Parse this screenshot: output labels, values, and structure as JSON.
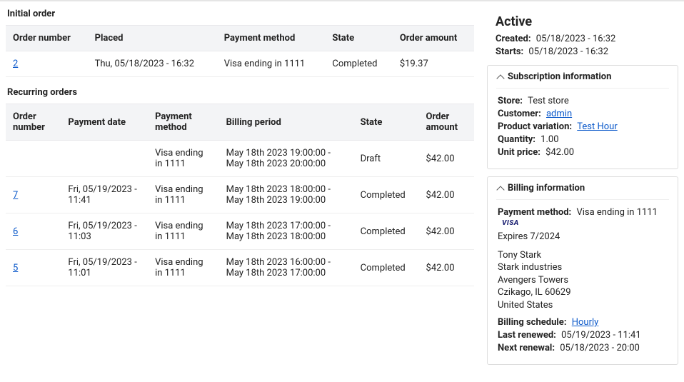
{
  "initialOrder": {
    "title": "Initial order",
    "headers": {
      "orderNumber": "Order number",
      "placed": "Placed",
      "paymentMethod": "Payment method",
      "state": "State",
      "orderAmount": "Order amount"
    },
    "rows": [
      {
        "orderNumber": "2",
        "placed": "Thu, 05/18/2023 - 16:32",
        "paymentMethod": "Visa ending in 1111",
        "state": "Completed",
        "orderAmount": "$19.37"
      }
    ]
  },
  "recurringOrders": {
    "title": "Recurring orders",
    "headers": {
      "orderNumber": "Order number",
      "paymentDate": "Payment date",
      "paymentMethod": "Payment method",
      "billingPeriod": "Billing period",
      "state": "State",
      "orderAmount": "Order amount"
    },
    "rows": [
      {
        "orderNumber": "",
        "paymentDate": "",
        "paymentMethod": "Visa ending in 1111",
        "billingPeriod": "May 18th 2023 19:00:00 - May 18th 2023 20:00:00",
        "state": "Draft",
        "orderAmount": "$42.00"
      },
      {
        "orderNumber": "7",
        "paymentDate": "Fri, 05/19/2023 - 11:41",
        "paymentMethod": "Visa ending in 1111",
        "billingPeriod": "May 18th 2023 18:00:00 - May 18th 2023 19:00:00",
        "state": "Completed",
        "orderAmount": "$42.00"
      },
      {
        "orderNumber": "6",
        "paymentDate": "Fri, 05/19/2023 - 11:03",
        "paymentMethod": "Visa ending in 1111",
        "billingPeriod": "May 18th 2023 17:00:00 - May 18th 2023 18:00:00",
        "state": "Completed",
        "orderAmount": "$42.00"
      },
      {
        "orderNumber": "5",
        "paymentDate": "Fri, 05/19/2023 - 11:01",
        "paymentMethod": "Visa ending in 1111",
        "billingPeriod": "May 18th 2023 16:00:00 - May 18th 2023 17:00:00",
        "state": "Completed",
        "orderAmount": "$42.00"
      }
    ]
  },
  "statusCard": {
    "status": "Active",
    "createdLabel": "Created:",
    "createdValue": "05/18/2023 - 16:32",
    "startsLabel": "Starts:",
    "startsValue": "05/18/2023 - 16:32"
  },
  "subscriptionInfo": {
    "title": "Subscription information",
    "storeLabel": "Store:",
    "storeValue": "Test store",
    "customerLabel": "Customer:",
    "customerValue": "admin",
    "productVariationLabel": "Product variation:",
    "productVariationValue": "Test Hour",
    "quantityLabel": "Quantity:",
    "quantityValue": "1.00",
    "unitPriceLabel": "Unit price:",
    "unitPriceValue": "$42.00"
  },
  "billingInfo": {
    "title": "Billing information",
    "paymentMethodLabel": "Payment method:",
    "paymentMethodValue": "Visa ending in 1111",
    "visaBadge": "VISA",
    "expires": "Expires 7/2024",
    "address": [
      "Tony Stark",
      "Stark industries",
      "Avengers Towers",
      "Czikago, IL 60629",
      "United States"
    ],
    "billingScheduleLabel": "Billing schedule:",
    "billingScheduleValue": "Hourly",
    "lastRenewedLabel": "Last renewed:",
    "lastRenewedValue": "05/19/2023 - 11:41",
    "nextRenewalLabel": "Next renewal:",
    "nextRenewalValue": "05/18/2023 - 20:00"
  }
}
